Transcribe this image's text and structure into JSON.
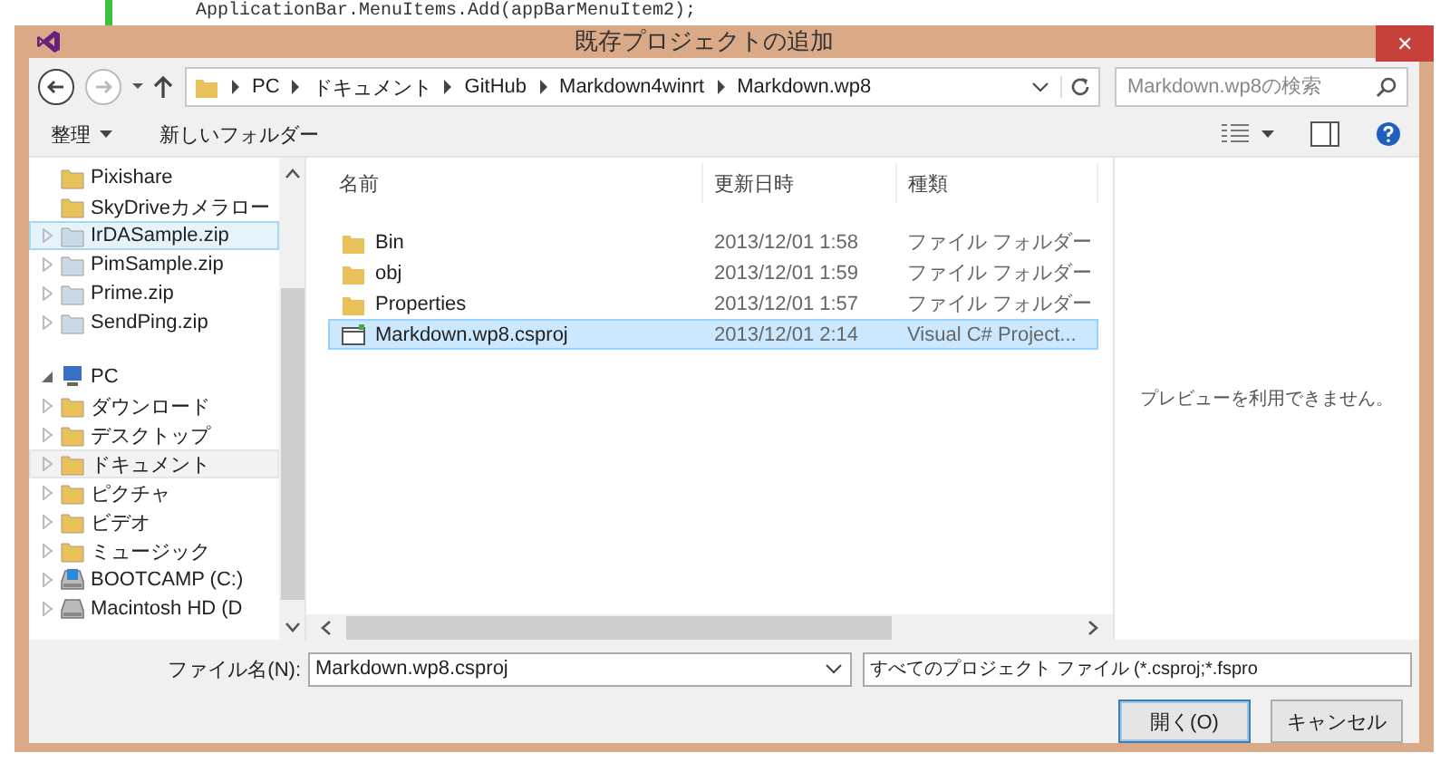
{
  "background_editor": {
    "code_line": "ApplicationBar.MenuItems.Add(appBarMenuItem2);"
  },
  "window": {
    "title": "既存プロジェクトの追加",
    "close": "✕"
  },
  "address_bar": {
    "path": [
      "PC",
      "ドキュメント",
      "GitHub",
      "Markdown4winrt",
      "Markdown.wp8"
    ]
  },
  "search": {
    "placeholder": "Markdown.wp8の検索"
  },
  "toolbar": {
    "buttons": [
      {
        "label": "整理",
        "dropdown": true
      },
      {
        "label": "新しいフォルダー",
        "dropdown": false
      }
    ]
  },
  "sidebar": {
    "items": [
      {
        "label": "Pixishare",
        "kind": "folder",
        "selected": false,
        "hovered": false,
        "has_children": false
      },
      {
        "label": "SkyDriveカメラロー",
        "kind": "folder",
        "selected": false,
        "hovered": false,
        "has_children": false
      },
      {
        "label": "IrDASample.zip",
        "kind": "zip",
        "selected": true,
        "hovered": false,
        "has_children": true
      },
      {
        "label": "PimSample.zip",
        "kind": "zip",
        "selected": false,
        "hovered": false,
        "has_children": true
      },
      {
        "label": "Prime.zip",
        "kind": "zip",
        "selected": false,
        "hovered": false,
        "has_children": true
      },
      {
        "label": "SendPing.zip",
        "kind": "zip",
        "selected": false,
        "hovered": false,
        "has_children": true
      },
      {
        "label": "PC",
        "kind": "pc",
        "selected": false,
        "hovered": false,
        "has_children": true,
        "expanded": true,
        "children": [
          {
            "label": "ダウンロード",
            "kind": "download",
            "selected": false,
            "hovered": false,
            "has_children": true
          },
          {
            "label": "デスクトップ",
            "kind": "desktop",
            "selected": false,
            "hovered": false,
            "has_children": true
          },
          {
            "label": "ドキュメント",
            "kind": "documents",
            "selected": false,
            "hovered": true,
            "has_children": true
          },
          {
            "label": "ピクチャ",
            "kind": "pictures",
            "selected": false,
            "hovered": false,
            "has_children": true
          },
          {
            "label": "ビデオ",
            "kind": "videos",
            "selected": false,
            "hovered": false,
            "has_children": true
          },
          {
            "label": "ミュージック",
            "kind": "music",
            "selected": false,
            "hovered": false,
            "has_children": true
          },
          {
            "label": "BOOTCAMP (C:)",
            "kind": "windrive",
            "selected": false,
            "hovered": false,
            "has_children": true
          },
          {
            "label": "Macintosh HD (D",
            "kind": "drive",
            "selected": false,
            "hovered": false,
            "has_children": true
          }
        ]
      }
    ]
  },
  "file_list": {
    "columns": [
      "名前",
      "更新日時",
      "種類"
    ],
    "rows": [
      {
        "name": "Bin",
        "date": "2013/12/01 1:58",
        "type": "ファイル フォルダー",
        "kind": "folder",
        "selected": false
      },
      {
        "name": "obj",
        "date": "2013/12/01 1:59",
        "type": "ファイル フォルダー",
        "kind": "folder",
        "selected": false
      },
      {
        "name": "Properties",
        "date": "2013/12/01 1:57",
        "type": "ファイル フォルダー",
        "kind": "folder",
        "selected": false
      },
      {
        "name": "Markdown.wp8.csproj",
        "date": "2013/12/01 2:14",
        "type": "Visual C# Project...",
        "kind": "project",
        "selected": true
      }
    ]
  },
  "preview": {
    "message": "プレビューを利用できません。"
  },
  "file_name": {
    "label": "ファイル名(N):",
    "value": "Markdown.wp8.csproj"
  },
  "file_type": {
    "value": "すべてのプロジェクト ファイル (*.csproj;*.fspro"
  },
  "buttons": [
    {
      "label": "開く(O)",
      "default": true
    },
    {
      "label": "キャンセル",
      "default": false
    }
  ]
}
